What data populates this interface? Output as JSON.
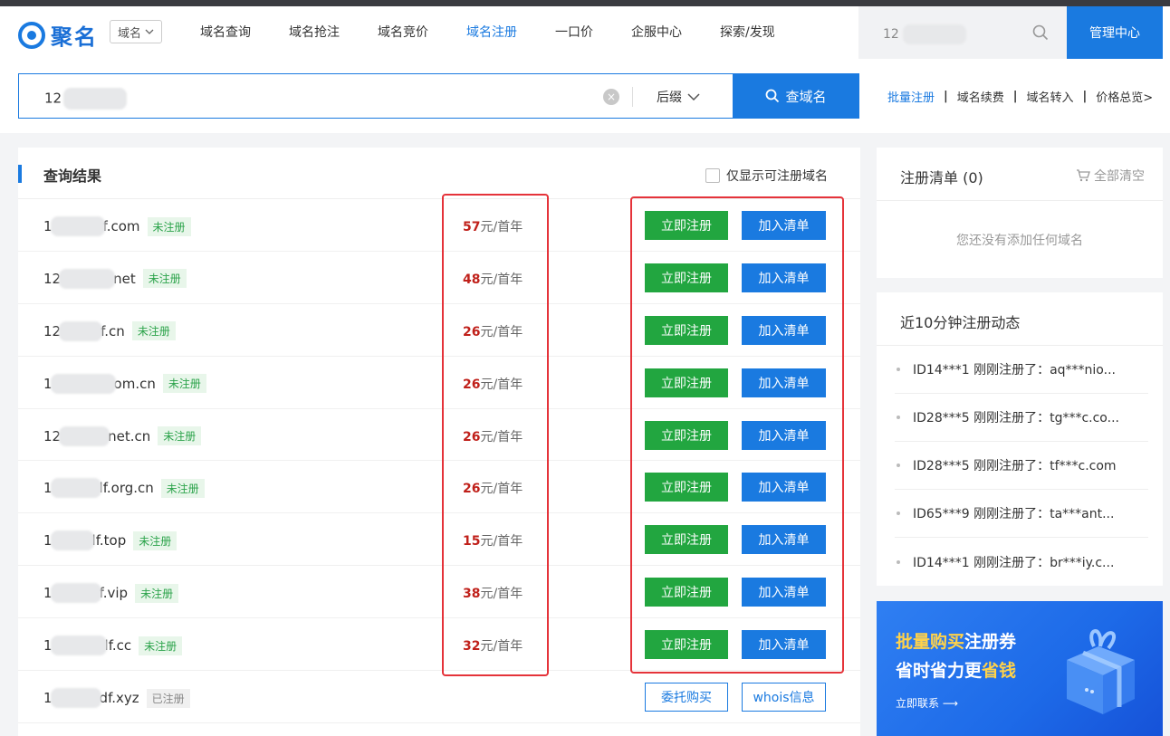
{
  "header": {
    "logo_text": "聚名",
    "domain_select": "域名",
    "nav": [
      "域名查询",
      "域名抢注",
      "域名竞价",
      "域名注册",
      "一口价",
      "企服中心",
      "探索/发现"
    ],
    "nav_active_index": 3,
    "search_value": "12",
    "manage_button": "管理中心"
  },
  "search": {
    "query": "12",
    "suffix_label": "后缀",
    "button_label": "查域名",
    "quick_links": [
      "批量注册",
      "域名续费",
      "域名转入",
      "价格总览>"
    ]
  },
  "results": {
    "title": "查询结果",
    "only_available_label": "仅显示可注册域名",
    "price_unit": "元/首年",
    "rows": [
      {
        "prefix": "1",
        "suffix": "f.com",
        "status": "未注册",
        "price": "57",
        "taken": false,
        "btn1": "立即注册",
        "btn2": "加入清单"
      },
      {
        "prefix": "12",
        "suffix": "net",
        "status": "未注册",
        "price": "48",
        "taken": false,
        "btn1": "立即注册",
        "btn2": "加入清单"
      },
      {
        "prefix": "12",
        "suffix": "f.cn",
        "status": "未注册",
        "price": "26",
        "taken": false,
        "btn1": "立即注册",
        "btn2": "加入清单"
      },
      {
        "prefix": "1",
        "suffix": "om.cn",
        "status": "未注册",
        "price": "26",
        "taken": false,
        "btn1": "立即注册",
        "btn2": "加入清单"
      },
      {
        "prefix": "12",
        "suffix": "net.cn",
        "status": "未注册",
        "price": "26",
        "taken": false,
        "btn1": "立即注册",
        "btn2": "加入清单"
      },
      {
        "prefix": "1",
        "suffix": "lf.org.cn",
        "status": "未注册",
        "price": "26",
        "taken": false,
        "btn1": "立即注册",
        "btn2": "加入清单"
      },
      {
        "prefix": "1",
        "suffix": "lf.top",
        "status": "未注册",
        "price": "15",
        "taken": false,
        "btn1": "立即注册",
        "btn2": "加入清单"
      },
      {
        "prefix": "1",
        "suffix": "f.vip",
        "status": "未注册",
        "price": "38",
        "taken": false,
        "btn1": "立即注册",
        "btn2": "加入清单"
      },
      {
        "prefix": "1",
        "suffix": "lf.cc",
        "status": "未注册",
        "price": "32",
        "taken": false,
        "btn1": "立即注册",
        "btn2": "加入清单"
      },
      {
        "prefix": "1",
        "suffix": "df.xyz",
        "status": "已注册",
        "price": "",
        "taken": true,
        "btn1": "委托购买",
        "btn2": "whois信息"
      }
    ]
  },
  "cart": {
    "title": "注册清单 (0)",
    "clear_label": "全部清空",
    "empty_text": "您还没有添加任何域名"
  },
  "recent": {
    "title": "近10分钟注册动态",
    "items": [
      "ID14***1 刚刚注册了：aq***nio...",
      "ID28***5 刚刚注册了：tg***c.co...",
      "ID28***5 刚刚注册了：tf***c.com",
      "ID65***9 刚刚注册了：ta***ant...",
      "ID14***1 刚刚注册了：br***iy.c..."
    ]
  },
  "banner": {
    "line1_a": "批量购买",
    "line1_b": "注册券",
    "line2_a": "省时省力更",
    "line2_b": "省钱",
    "cta": "立即联系 ⟶"
  },
  "colors": {
    "brand_blue": "#1a7ae0",
    "register_green": "#22a640",
    "price_red": "#c0201a",
    "annotation_red": "#e5333a"
  }
}
